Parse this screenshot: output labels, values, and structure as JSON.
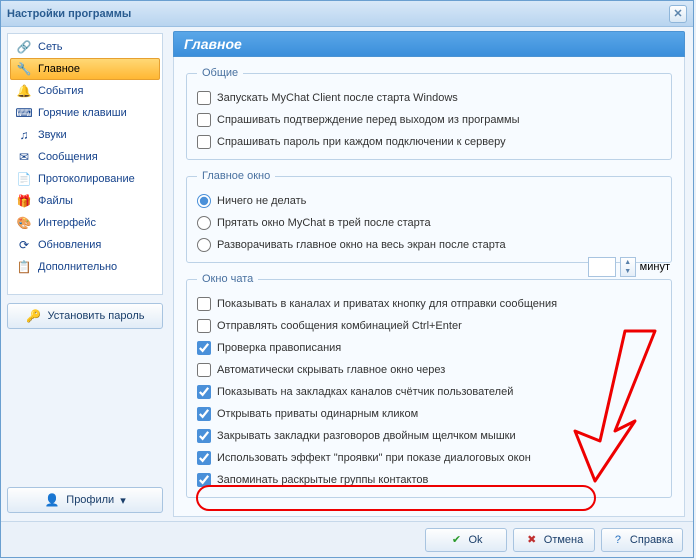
{
  "window": {
    "title": "Настройки программы"
  },
  "sidebar": {
    "items": [
      {
        "label": "Сеть",
        "icon": "🔗"
      },
      {
        "label": "Главное",
        "icon": "🔧"
      },
      {
        "label": "События",
        "icon": "🔔"
      },
      {
        "label": "Горячие клавиши",
        "icon": "⌨"
      },
      {
        "label": "Звуки",
        "icon": "♫"
      },
      {
        "label": "Сообщения",
        "icon": "✉"
      },
      {
        "label": "Протоколирование",
        "icon": "📄"
      },
      {
        "label": "Файлы",
        "icon": "🎁"
      },
      {
        "label": "Интерфейс",
        "icon": "🎨"
      },
      {
        "label": "Обновления",
        "icon": "⟳"
      },
      {
        "label": "Дополнительно",
        "icon": "📋"
      }
    ],
    "set_password": "Установить пароль",
    "profiles": "Профили"
  },
  "main": {
    "title": "Главное",
    "groups": {
      "general": {
        "legend": "Общие",
        "items": [
          {
            "label": "Запускать MyChat Client после старта Windows",
            "checked": false
          },
          {
            "label": "Спрашивать подтверждение перед выходом из программы",
            "checked": false
          },
          {
            "label": "Спрашивать пароль при каждом подключении к серверу",
            "checked": false
          }
        ]
      },
      "mainwin": {
        "legend": "Главное окно",
        "items": [
          {
            "label": "Ничего не делать",
            "checked": true
          },
          {
            "label": "Прятать окно MyChat в трей после старта",
            "checked": false
          },
          {
            "label": "Разворачивать главное окно на весь экран после старта",
            "checked": false
          }
        ]
      },
      "chat": {
        "legend": "Окно чата",
        "items": [
          {
            "label": "Показывать в каналах и приватах кнопку для отправки сообщения",
            "checked": false
          },
          {
            "label": "Отправлять сообщения комбинацией Ctrl+Enter",
            "checked": false
          },
          {
            "label": "Проверка правописания",
            "checked": true
          },
          {
            "label": "Автоматически скрывать главное окно через",
            "checked": false
          },
          {
            "label": "Показывать на закладках каналов счётчик пользователей",
            "checked": true
          },
          {
            "label": "Открывать приваты одинарным кликом",
            "checked": true
          },
          {
            "label": "Закрывать закладки разговоров двойным щелчком мышки",
            "checked": true
          },
          {
            "label": "Использовать эффект \"проявки\" при показе диалоговых окон",
            "checked": true
          },
          {
            "label": "Запоминать раскрытые группы контактов",
            "checked": true
          }
        ],
        "spin_unit": "минут"
      }
    }
  },
  "footer": {
    "ok": "Ok",
    "cancel": "Отмена",
    "help": "Справка"
  }
}
